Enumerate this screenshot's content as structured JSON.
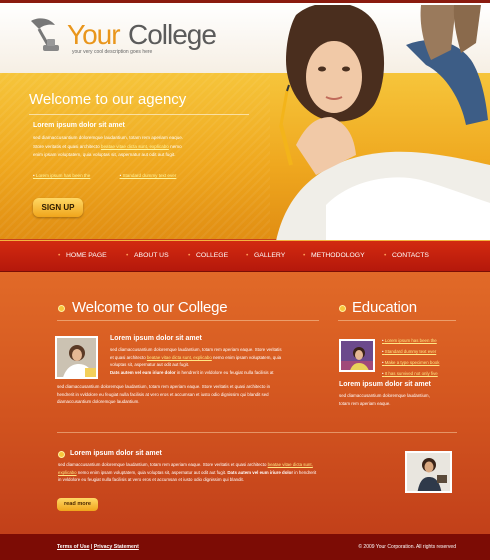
{
  "header": {
    "logo_your": "Your",
    "logo_college": "College",
    "tagline": "your very cool description goes here"
  },
  "hero": {
    "title": "Welcome to our agency",
    "heading": "Lorem ipsum dolor sit amet",
    "text_1": "sed diamaccusantium doloremque laudantium, totam rem aperiam eaque.",
    "text_2a": "Store veritatis et quasi architecto ",
    "text_2_link": "beatae vitae dicta sunt, explicabo",
    "text_2b": " nemo",
    "text_3": "enim ipsam voluptatem, quia voluptas sit, aspernatur aut odit aut fugit.",
    "link_1": "Lorem ipsum has been the",
    "link_2": "Standard dummy text ever",
    "signup_label": "SIGN UP"
  },
  "nav": {
    "items": [
      "HOME PAGE",
      "ABOUT US",
      "COLLEGE",
      "GALLERY",
      "METHODOLOGY",
      "CONTACTS"
    ]
  },
  "welcome": {
    "title": "Welcome to our College",
    "heading": "Lorem ipsum dolor sit amet",
    "p1_a": "sed diamaccusantium doloremque laudantium, totam rem aperiam eaque. Store veritatis",
    "p1_b": "et quasi architecto ",
    "p1_link": "beatae vitae dicta sunt, explicabo",
    "p1_c": " nemo enim ipsam voluptatem, quia",
    "p1_d": "voluptas sit, aspernatur aut odit aut fugit.",
    "p1_bold": "Dats autem vel eum iriure dolor",
    "p1_e": " in hendrerit in vvldolore eu feugiat nulla facilisis at",
    "p2_a": "sed diamaccusantium doloremque laudantium, totam rem aperiam eaque. Store veritatis et quasi architecto in",
    "p2_b": "hendrerit in vvldolore eu feugiat nulla facilisis at vero eros et accumsan et iusto odio dignissim qui blandit sed",
    "p2_c": "diamaccusantium doloremque laudantium."
  },
  "education": {
    "title": "Education",
    "links": [
      "Lorem ipsum has been the",
      "Standard dummy text ever",
      "Make a type specimen book",
      "It has survived not only five"
    ],
    "heading": "Lorem ipsum dolor sit amet",
    "text_1": "sed diamaccusantium doloremque laudantium,",
    "text_2": "totam rem aperiam eaque."
  },
  "bottom": {
    "heading": "Lorem ipsum dolor sit amet",
    "l1_a": "sed diamaccusantium doloremque laudantium, totam rem aperiam eaque. Store veritatis et quasi architecto ",
    "l1_link": "beatae vitae dicta sunt,",
    "l2_link": "explicabo",
    "l2_a": " nemo enim ipsam voluptatem, quia voluptas sit, aspernatur aut odit aut fugit. ",
    "l2_bold": "Dats autem vel eum iriure dolor",
    "l2_b": " in hendrerit",
    "l3": "in vvldolore eu feugiat nulla facilisis at vero eros et accumsan et iusto odio dignissim qui blandit.",
    "readmore_label": "read more"
  },
  "footer": {
    "terms": "Terms of Use",
    "sep": " | ",
    "privacy": "Privacy Statement",
    "copyright": "© 2009 Your Corporation. All rights reserved"
  },
  "colors": {
    "accent_orange": "#e9961c",
    "nav_red": "#c9210e",
    "footer_dark": "#7c0c05"
  }
}
